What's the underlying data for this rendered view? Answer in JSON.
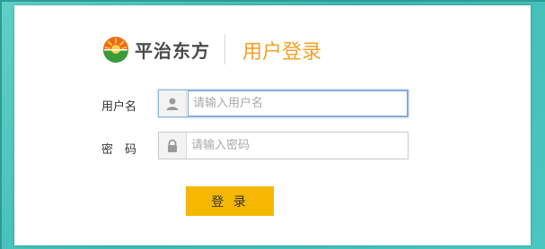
{
  "brand": {
    "name": "平治东方",
    "logo_icon": "sun-logo-icon"
  },
  "title": "用户登录",
  "username": {
    "label": "用户名",
    "placeholder": "请输入用户名",
    "value": "",
    "icon": "user-icon"
  },
  "password": {
    "label": "密　码",
    "placeholder": "请输入密码",
    "value": "",
    "icon": "lock-icon"
  },
  "login_button": {
    "label": "登 录"
  },
  "colors": {
    "accent": "#f5a02a",
    "button": "#f5b700",
    "background": "#4cc7bf",
    "brand_green": "#3a9a3a",
    "brand_orange": "#f06a1a"
  }
}
